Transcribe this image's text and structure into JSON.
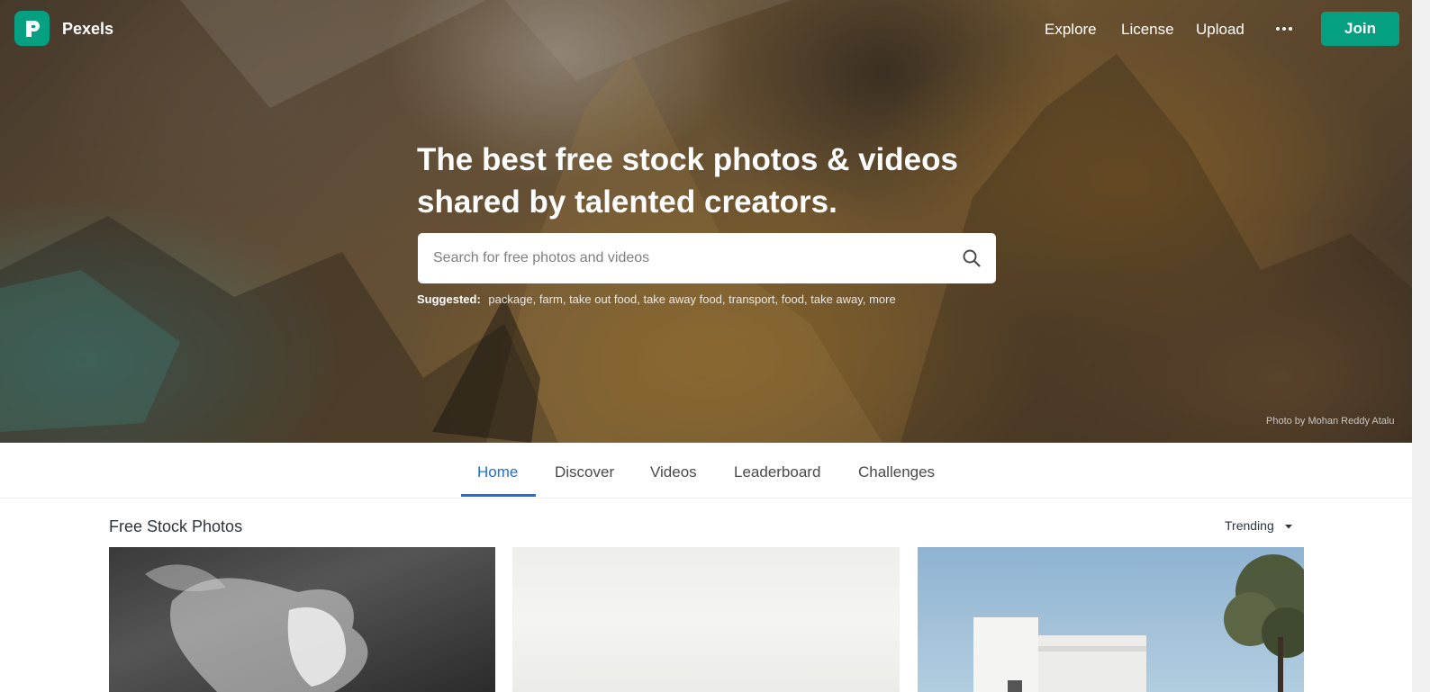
{
  "brand": {
    "name": "Pexels",
    "color": "#05a081"
  },
  "nav": {
    "explore": "Explore",
    "license": "License",
    "upload": "Upload",
    "more_icon": "more-dots-icon",
    "join": "Join"
  },
  "hero": {
    "headline_line1": "The best free stock photos & videos",
    "headline_line2": "shared by talented creators.",
    "search_placeholder": "Search for free photos and videos",
    "suggested_label": "Suggested:",
    "suggestions": [
      "package,",
      "farm,",
      "take out food,",
      "take away food,",
      "transport,",
      "food,",
      "take away,",
      "more"
    ],
    "credit": "Photo by Mohan Reddy Atalu"
  },
  "tabs": [
    {
      "label": "Home",
      "active": true
    },
    {
      "label": "Discover",
      "active": false
    },
    {
      "label": "Videos",
      "active": false
    },
    {
      "label": "Leaderboard",
      "active": false
    },
    {
      "label": "Challenges",
      "active": false
    }
  ],
  "section": {
    "title": "Free Stock Photos",
    "sort": "Trending"
  },
  "colors": {
    "accent_tab": "#1e6ed8",
    "join_button": "#05a081"
  }
}
